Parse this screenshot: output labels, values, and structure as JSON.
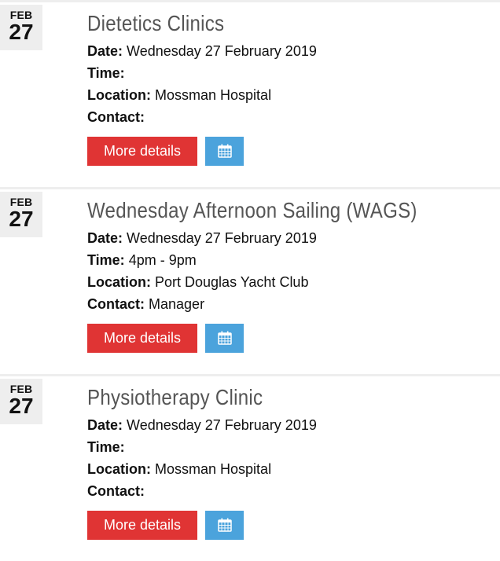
{
  "events": [
    {
      "month": "FEB",
      "day": "27",
      "title": "Dietetics Clinics",
      "date_label": "Date:",
      "date_value": "Wednesday 27 February 2019",
      "time_label": "Time:",
      "time_value": "",
      "location_label": "Location:",
      "location_value": "Mossman Hospital",
      "contact_label": "Contact:",
      "contact_value": "",
      "more_label": "More details",
      "calendar_icon": "calendar-icon"
    },
    {
      "month": "FEB",
      "day": "27",
      "title": "Wednesday Afternoon Sailing (WAGS)",
      "date_label": "Date:",
      "date_value": "Wednesday 27 February 2019",
      "time_label": "Time:",
      "time_value": "4pm - 9pm",
      "location_label": "Location:",
      "location_value": "Port Douglas Yacht Club",
      "contact_label": "Contact:",
      "contact_value": "Manager",
      "more_label": "More details",
      "calendar_icon": "calendar-icon"
    },
    {
      "month": "FEB",
      "day": "27",
      "title": "Physiotherapy Clinic",
      "date_label": "Date:",
      "date_value": "Wednesday 27 February 2019",
      "time_label": "Time:",
      "time_value": "",
      "location_label": "Location:",
      "location_value": "Mossman Hospital",
      "contact_label": "Contact:",
      "contact_value": "",
      "more_label": "More details",
      "calendar_icon": "calendar-icon"
    }
  ],
  "colors": {
    "more_button": "#e03434",
    "calendar_button": "#4ba3dc",
    "date_badge_bg": "#eeeeee",
    "title_text": "#555555"
  }
}
